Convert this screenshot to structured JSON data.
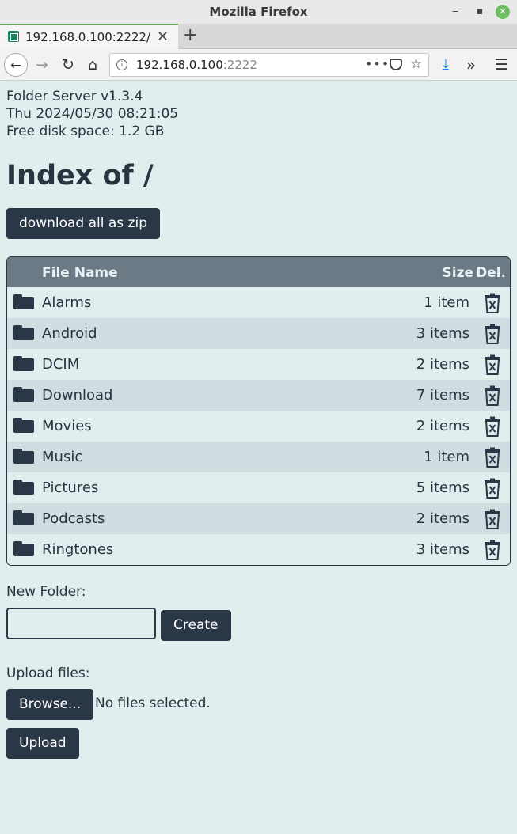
{
  "window": {
    "title": "Mozilla Firefox"
  },
  "tab": {
    "label": "192.168.0.100:2222/",
    "close": "✕",
    "new_tab": "+"
  },
  "nav": {
    "back": "←",
    "forward": "→",
    "reload": "↻",
    "home": "⌂",
    "url_host": "192.168.0.100",
    "url_port": ":2222",
    "page_actions": "•••",
    "bookmark": "☆",
    "downloads": "⤓",
    "overflow": "»",
    "menu": "☰"
  },
  "server": {
    "version": "Folder Server v1.3.4",
    "datetime": "Thu 2024/05/30 08:21:05",
    "free_space": "Free disk space: 1.2 GB"
  },
  "page": {
    "heading": "Index of /",
    "zip_button": "download all as zip"
  },
  "table": {
    "headers": {
      "name": "File Name",
      "size": "Size",
      "delete": "Del."
    },
    "rows": [
      {
        "name": "Alarms",
        "size": "1 item"
      },
      {
        "name": "Android",
        "size": "3 items"
      },
      {
        "name": "DCIM",
        "size": "2 items"
      },
      {
        "name": "Download",
        "size": "7 items"
      },
      {
        "name": "Movies",
        "size": "2 items"
      },
      {
        "name": "Music",
        "size": "1 item"
      },
      {
        "name": "Pictures",
        "size": "5 items"
      },
      {
        "name": "Podcasts",
        "size": "2 items"
      },
      {
        "name": "Ringtones",
        "size": "3 items"
      }
    ]
  },
  "new_folder": {
    "label": "New Folder:",
    "value": "",
    "button": "Create"
  },
  "upload": {
    "label": "Upload files:",
    "browse": "Browse...",
    "status": "No files selected.",
    "button": "Upload"
  },
  "icons": {
    "row": "folder-icon",
    "delete": "trash-icon"
  },
  "colors": {
    "accent": "#2a3746",
    "background": "#e2eeee",
    "row_alt": "#d0dde1",
    "header": "#6c7a85"
  }
}
